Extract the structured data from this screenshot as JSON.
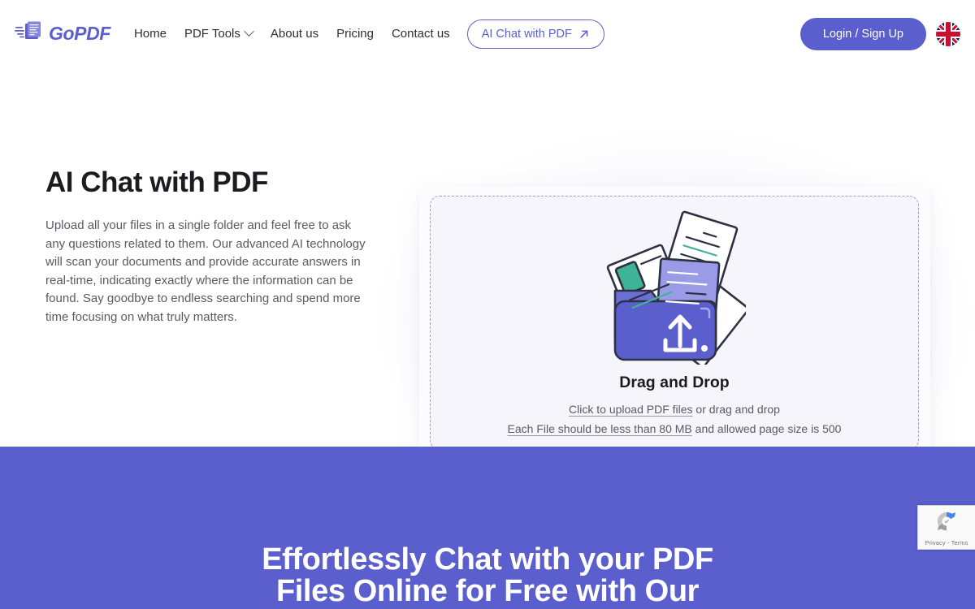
{
  "brand": {
    "name": "GoPDF",
    "logo_icon": "pdf-document-speed-icon",
    "accent_color": "#5B5FCD"
  },
  "nav": {
    "items": [
      {
        "label": "Home",
        "icon": null
      },
      {
        "label": "PDF Tools",
        "icon": "chevron-down-icon"
      },
      {
        "label": "About us",
        "icon": null
      },
      {
        "label": "Pricing",
        "icon": null
      },
      {
        "label": "Contact us",
        "icon": null
      }
    ],
    "cta": {
      "label": "AI Chat with PDF",
      "icon": "arrow-up-right-icon"
    }
  },
  "header_right": {
    "login_label": "Login / Sign Up",
    "language_flag": "uk-flag-icon"
  },
  "hero": {
    "title": "AI Chat with PDF",
    "paragraph": "Upload all your files in a single folder and feel free to ask any questions related to them. Our advanced AI technology will scan your documents and provide accurate answers in real-time, indicating exactly where the information can be found. Say goodbye to endless searching and spend more time focusing on what truly matters."
  },
  "dropzone": {
    "illustration_icon": "folder-upload-documents-illustration",
    "title": "Drag and Drop",
    "click_link": "Click to upload PDF files",
    "click_suffix": " or drag and drop",
    "limit_link": "Each File should be less than 80 MB",
    "limit_suffix": " and allowed page size is 500"
  },
  "promo": {
    "heading_line1": "Effortlessly Chat with your PDF",
    "heading_line2": "Files Online for Free with Our",
    "background_color": "#5B5FCD"
  },
  "recaptcha": {
    "icon": "recaptcha-logo-icon",
    "legal": "Privacy - Terms"
  }
}
